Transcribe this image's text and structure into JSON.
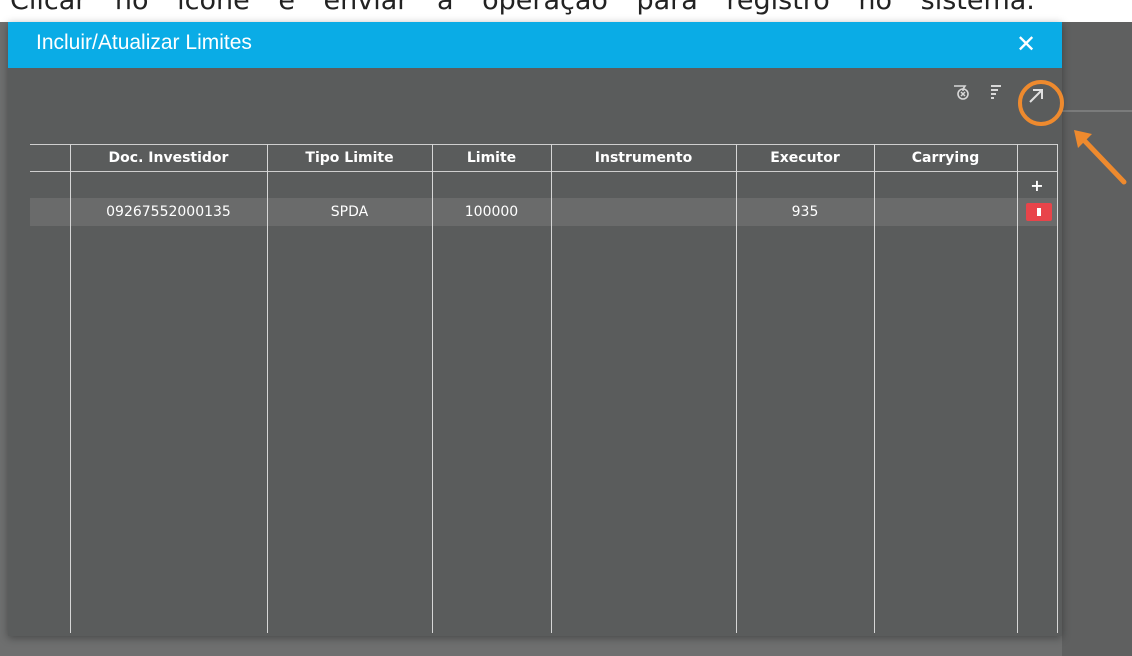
{
  "caption": {
    "text": "Clicar no ícone e enviar a operação para registro no sistema."
  },
  "dialog": {
    "title": "Incluir/Atualizar Limites",
    "close_label": "✕"
  },
  "toolbar": {
    "icons": [
      "clear-filter-icon",
      "filter-list-icon",
      "export-arrow-icon"
    ]
  },
  "table": {
    "columns": [
      "Doc. Investidor",
      "Tipo Limite",
      "Limite",
      "Instrumento",
      "Executor",
      "Carrying"
    ],
    "add_label": "+",
    "rows": [
      {
        "doc_investidor": "09267552000135",
        "tipo_limite": "SPDA",
        "limite": "100000",
        "instrumento": "",
        "executor": "935",
        "carrying": ""
      }
    ]
  },
  "colors": {
    "titlebar": "#0aace6",
    "dialog_bg": "#5a5c5c",
    "highlight": "#ee8a2e",
    "delete": "#e8444a"
  }
}
